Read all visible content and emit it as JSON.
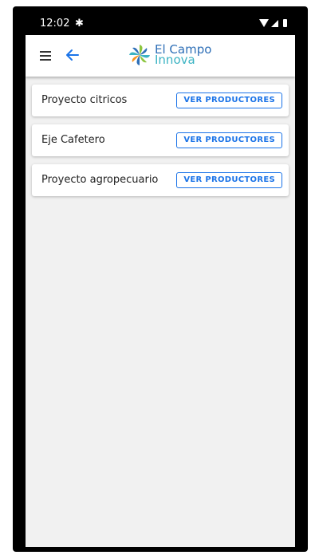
{
  "status_bar": {
    "time": "12:02",
    "settings_icon": "gear-icon",
    "icons": [
      "wifi-icon",
      "signal-icon",
      "battery-icon"
    ]
  },
  "app_bar": {
    "menu_icon": "hamburger-menu-icon",
    "back_icon": "arrow-left-icon",
    "logo": {
      "line1": "El Campo",
      "line2": "Innova",
      "colors": [
        "#2e6fb7",
        "#3bb3c3",
        "#8cc63f",
        "#f7941d"
      ]
    }
  },
  "projects": [
    {
      "name": "Proyecto citricos",
      "button": "VER PRODUCTORES"
    },
    {
      "name": "Eje Cafetero",
      "button": "VER PRODUCTORES"
    },
    {
      "name": "Proyecto agropecuario",
      "button": "VER PRODUCTORES"
    }
  ],
  "colors": {
    "accent": "#1a73e8",
    "background": "#f1f1f1"
  }
}
